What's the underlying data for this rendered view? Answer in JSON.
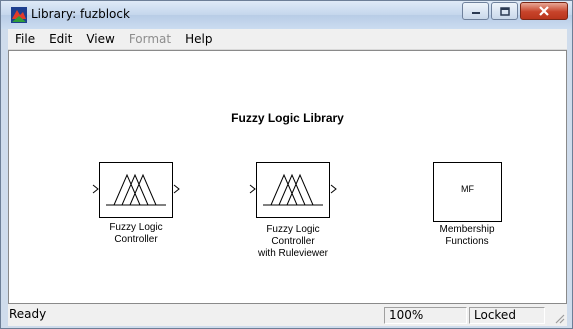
{
  "window": {
    "title": "Library: fuzblock"
  },
  "menu": [
    {
      "label": "File",
      "enabled": true
    },
    {
      "label": "Edit",
      "enabled": true
    },
    {
      "label": "View",
      "enabled": true
    },
    {
      "label": "Format",
      "enabled": false
    },
    {
      "label": "Help",
      "enabled": true
    }
  ],
  "canvas": {
    "title": "Fuzzy Logic Library",
    "blocks": [
      {
        "name": "fuzzy-logic-controller",
        "label_lines": [
          "Fuzzy Logic",
          "Controller"
        ]
      },
      {
        "name": "fuzzy-logic-controller-ruleviewer",
        "label_lines": [
          "Fuzzy Logic",
          "Controller",
          "with Ruleviewer"
        ]
      },
      {
        "name": "membership-functions",
        "label_lines": [
          "Membership",
          "Functions"
        ],
        "icon_text": "MF"
      }
    ]
  },
  "status": {
    "ready": "Ready",
    "zoom": "100%",
    "mode": "Locked"
  },
  "icons": [
    "simulink-app-icon",
    "minimize-icon",
    "maximize-icon",
    "close-icon",
    "resize-grip-icon"
  ],
  "colors": {
    "titlebar": "#c4d6ec",
    "close_button": "#c7432a",
    "canvas": "#ffffff"
  }
}
